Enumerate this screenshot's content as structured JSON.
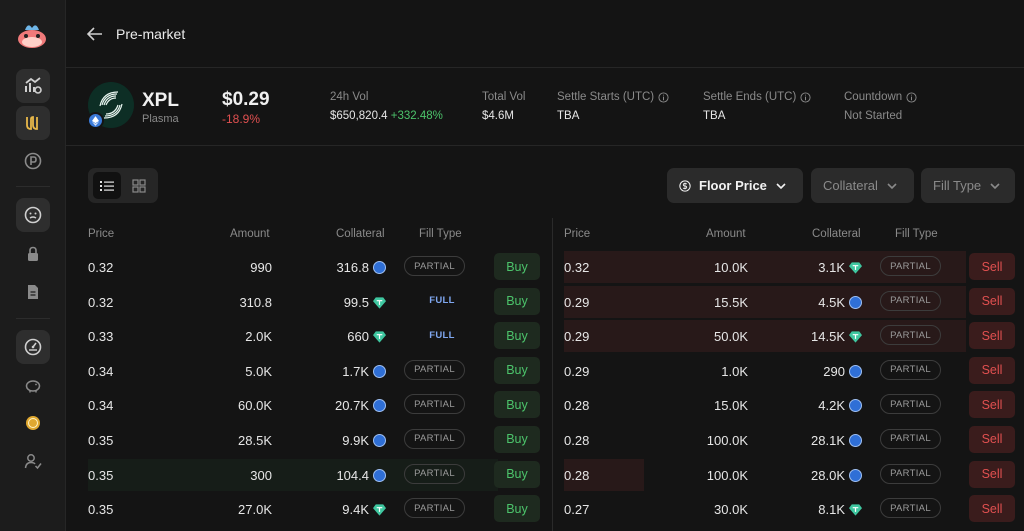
{
  "page": {
    "title": "Pre-market"
  },
  "token": {
    "symbol": "XPL",
    "name": "Plasma",
    "price": "$0.29",
    "change": "-18.9%"
  },
  "stats": {
    "vol24h_label": "24h Vol",
    "vol24h_value": "$650,820.4",
    "vol24h_change": "+332.48%",
    "total_vol_label": "Total Vol",
    "total_vol_value": "$4.6M",
    "settle_starts_label": "Settle Starts (UTC)",
    "settle_starts_value": "TBA",
    "settle_ends_label": "Settle Ends (UTC)",
    "settle_ends_value": "TBA",
    "countdown_label": "Countdown",
    "countdown_value": "Not Started"
  },
  "controls": {
    "floor_price": "Floor Price",
    "collateral": "Collateral",
    "fill_type": "Fill Type"
  },
  "table_headers": {
    "price": "Price",
    "amount": "Amount",
    "collateral": "Collateral",
    "fill_type": "Fill Type"
  },
  "buy_orders": [
    {
      "price": "0.32",
      "amount": "990",
      "collateral": "316.8",
      "coin": "usdc",
      "fill": "PARTIAL",
      "action": "Buy"
    },
    {
      "price": "0.32",
      "amount": "310.8",
      "collateral": "99.5",
      "coin": "usdt",
      "fill": "FULL",
      "action": "Buy"
    },
    {
      "price": "0.33",
      "amount": "2.0K",
      "collateral": "660",
      "coin": "usdt",
      "fill": "FULL",
      "action": "Buy"
    },
    {
      "price": "0.34",
      "amount": "5.0K",
      "collateral": "1.7K",
      "coin": "usdc",
      "fill": "PARTIAL",
      "action": "Buy"
    },
    {
      "price": "0.34",
      "amount": "60.0K",
      "collateral": "20.7K",
      "coin": "usdc",
      "fill": "PARTIAL",
      "action": "Buy"
    },
    {
      "price": "0.35",
      "amount": "28.5K",
      "collateral": "9.9K",
      "coin": "usdc",
      "fill": "PARTIAL",
      "action": "Buy"
    },
    {
      "price": "0.35",
      "amount": "300",
      "collateral": "104.4",
      "coin": "usdc",
      "fill": "PARTIAL",
      "action": "Buy"
    },
    {
      "price": "0.35",
      "amount": "27.0K",
      "collateral": "9.4K",
      "coin": "usdt",
      "fill": "PARTIAL",
      "action": "Buy"
    }
  ],
  "sell_orders": [
    {
      "price": "0.32",
      "amount": "10.0K",
      "collateral": "3.1K",
      "coin": "usdt",
      "fill": "PARTIAL",
      "action": "Sell"
    },
    {
      "price": "0.29",
      "amount": "15.5K",
      "collateral": "4.5K",
      "coin": "usdc",
      "fill": "PARTIAL",
      "action": "Sell"
    },
    {
      "price": "0.29",
      "amount": "50.0K",
      "collateral": "14.5K",
      "coin": "usdt",
      "fill": "PARTIAL",
      "action": "Sell"
    },
    {
      "price": "0.29",
      "amount": "1.0K",
      "collateral": "290",
      "coin": "usdc",
      "fill": "PARTIAL",
      "action": "Sell"
    },
    {
      "price": "0.28",
      "amount": "15.0K",
      "collateral": "4.2K",
      "coin": "usdc",
      "fill": "PARTIAL",
      "action": "Sell"
    },
    {
      "price": "0.28",
      "amount": "100.0K",
      "collateral": "28.1K",
      "coin": "usdc",
      "fill": "PARTIAL",
      "action": "Sell"
    },
    {
      "price": "0.28",
      "amount": "100.0K",
      "collateral": "28.0K",
      "coin": "usdc",
      "fill": "PARTIAL",
      "action": "Sell"
    },
    {
      "price": "0.27",
      "amount": "30.0K",
      "collateral": "8.1K",
      "coin": "usdt",
      "fill": "PARTIAL",
      "action": "Sell"
    }
  ],
  "sidebar": {
    "items": [
      {
        "icon": "chart-icon",
        "active": true
      },
      {
        "icon": "pre-market-icon",
        "active": true
      },
      {
        "icon": "points-icon",
        "active": false
      },
      {
        "icon": "chat-icon",
        "active": true
      },
      {
        "icon": "lock-icon",
        "active": false
      },
      {
        "icon": "document-icon",
        "active": false
      },
      {
        "icon": "dashboard-icon",
        "active": true
      },
      {
        "icon": "piggy-bank-icon",
        "active": false
      },
      {
        "icon": "coin-icon",
        "active": false
      },
      {
        "icon": "user-check-icon",
        "active": false
      }
    ]
  },
  "colors": {
    "accent_green": "#4cc36b",
    "accent_red": "#e05050",
    "usdc_blue": "#2f6fd6",
    "usdt_teal": "#3fc7a0"
  }
}
